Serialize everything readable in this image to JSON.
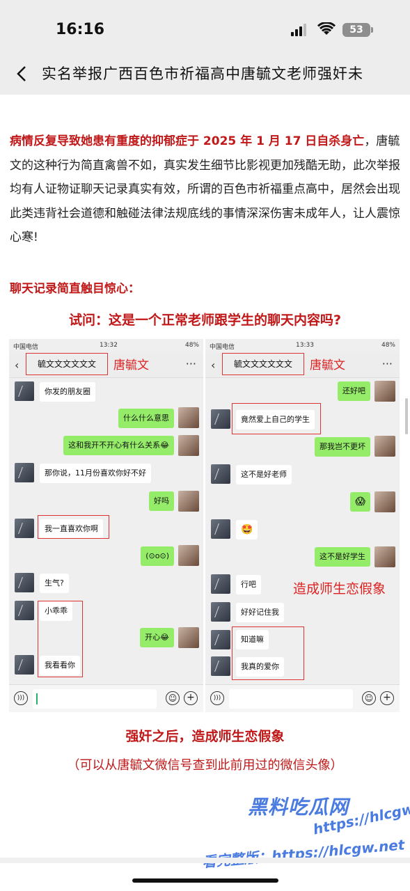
{
  "status_bar": {
    "time": "16:16",
    "battery": "53"
  },
  "nav": {
    "title": "实名举报广西百色市祈福高中唐毓文老师强奸未"
  },
  "article": {
    "lead_bold": "病情反复导致她患有重度的抑郁症于 2025 年 1 月 17 日自杀身亡",
    "lead_rest": "，唐毓文的这种行为简直禽兽不如，真实发生细节比影视更加残酷无助，此次举报均有人证物证聊天记录真实有效，所谓的百色市祈福重点高中，居然会出现此类违背社会道德和触碰法律法规底线的事情深深伤害未成年人，让人震惊心寒!",
    "subheading": "聊天记录简直触目惊心：",
    "question": "试问：这是一个正常老师跟学生的聊天内容吗?"
  },
  "left_shot": {
    "carrier": "中国电信",
    "time": "13:32",
    "battery": "48%",
    "contact": "毓文文文文文文",
    "tag": "唐毓文",
    "messages": [
      {
        "side": "left",
        "text": "你发的朋友圈"
      },
      {
        "side": "right",
        "text": "什么什么意思"
      },
      {
        "side": "right",
        "text": "这和我开不开心有什么关系😂"
      },
      {
        "side": "left",
        "text": "那你说，11月份喜欢你好不好"
      },
      {
        "side": "right",
        "text": "好吗"
      },
      {
        "side": "left",
        "text": "我一直喜欢你啊"
      },
      {
        "side": "right",
        "text": "(⊙o⊙)"
      },
      {
        "side": "left",
        "text": "生气?"
      },
      {
        "side": "left",
        "text": "小乖乖"
      },
      {
        "side": "right",
        "text": "开心😂"
      },
      {
        "side": "left",
        "text": "我看看你"
      }
    ]
  },
  "right_shot": {
    "carrier": "中国电信",
    "time": "13:33",
    "battery": "48%",
    "contact": "毓文文文文文文",
    "tag": "唐毓文",
    "overlay": "造成师生恋假象",
    "messages": [
      {
        "side": "right",
        "text": "还好吧"
      },
      {
        "side": "left",
        "text": "竟然爱上自己的学生"
      },
      {
        "side": "right",
        "text": "那我岂不更坏"
      },
      {
        "side": "left",
        "text": "这不是好老师"
      },
      {
        "side": "right",
        "text": "😱"
      },
      {
        "side": "left",
        "text": "🤩"
      },
      {
        "side": "right",
        "text": "这不是好学生"
      },
      {
        "side": "left",
        "text": "行吧"
      },
      {
        "side": "left",
        "text": "好好记住我"
      },
      {
        "side": "left",
        "text": "知道嘛"
      },
      {
        "side": "left",
        "text": "我真的爱你"
      }
    ]
  },
  "captions": {
    "main": "强奸之后，造成师生恋假象",
    "sub": "（可以从唐毓文微信号查到此前用过的微信头像）"
  },
  "watermark": {
    "brand": "黑料吃瓜网",
    "url": "https://hlcgw.net",
    "bottom": "看完整版：https://hlcgw.net"
  },
  "colors": {
    "accent_red": "#c01818",
    "bubble_green": "#95ec69",
    "watermark_blue": "#4a7be0"
  }
}
